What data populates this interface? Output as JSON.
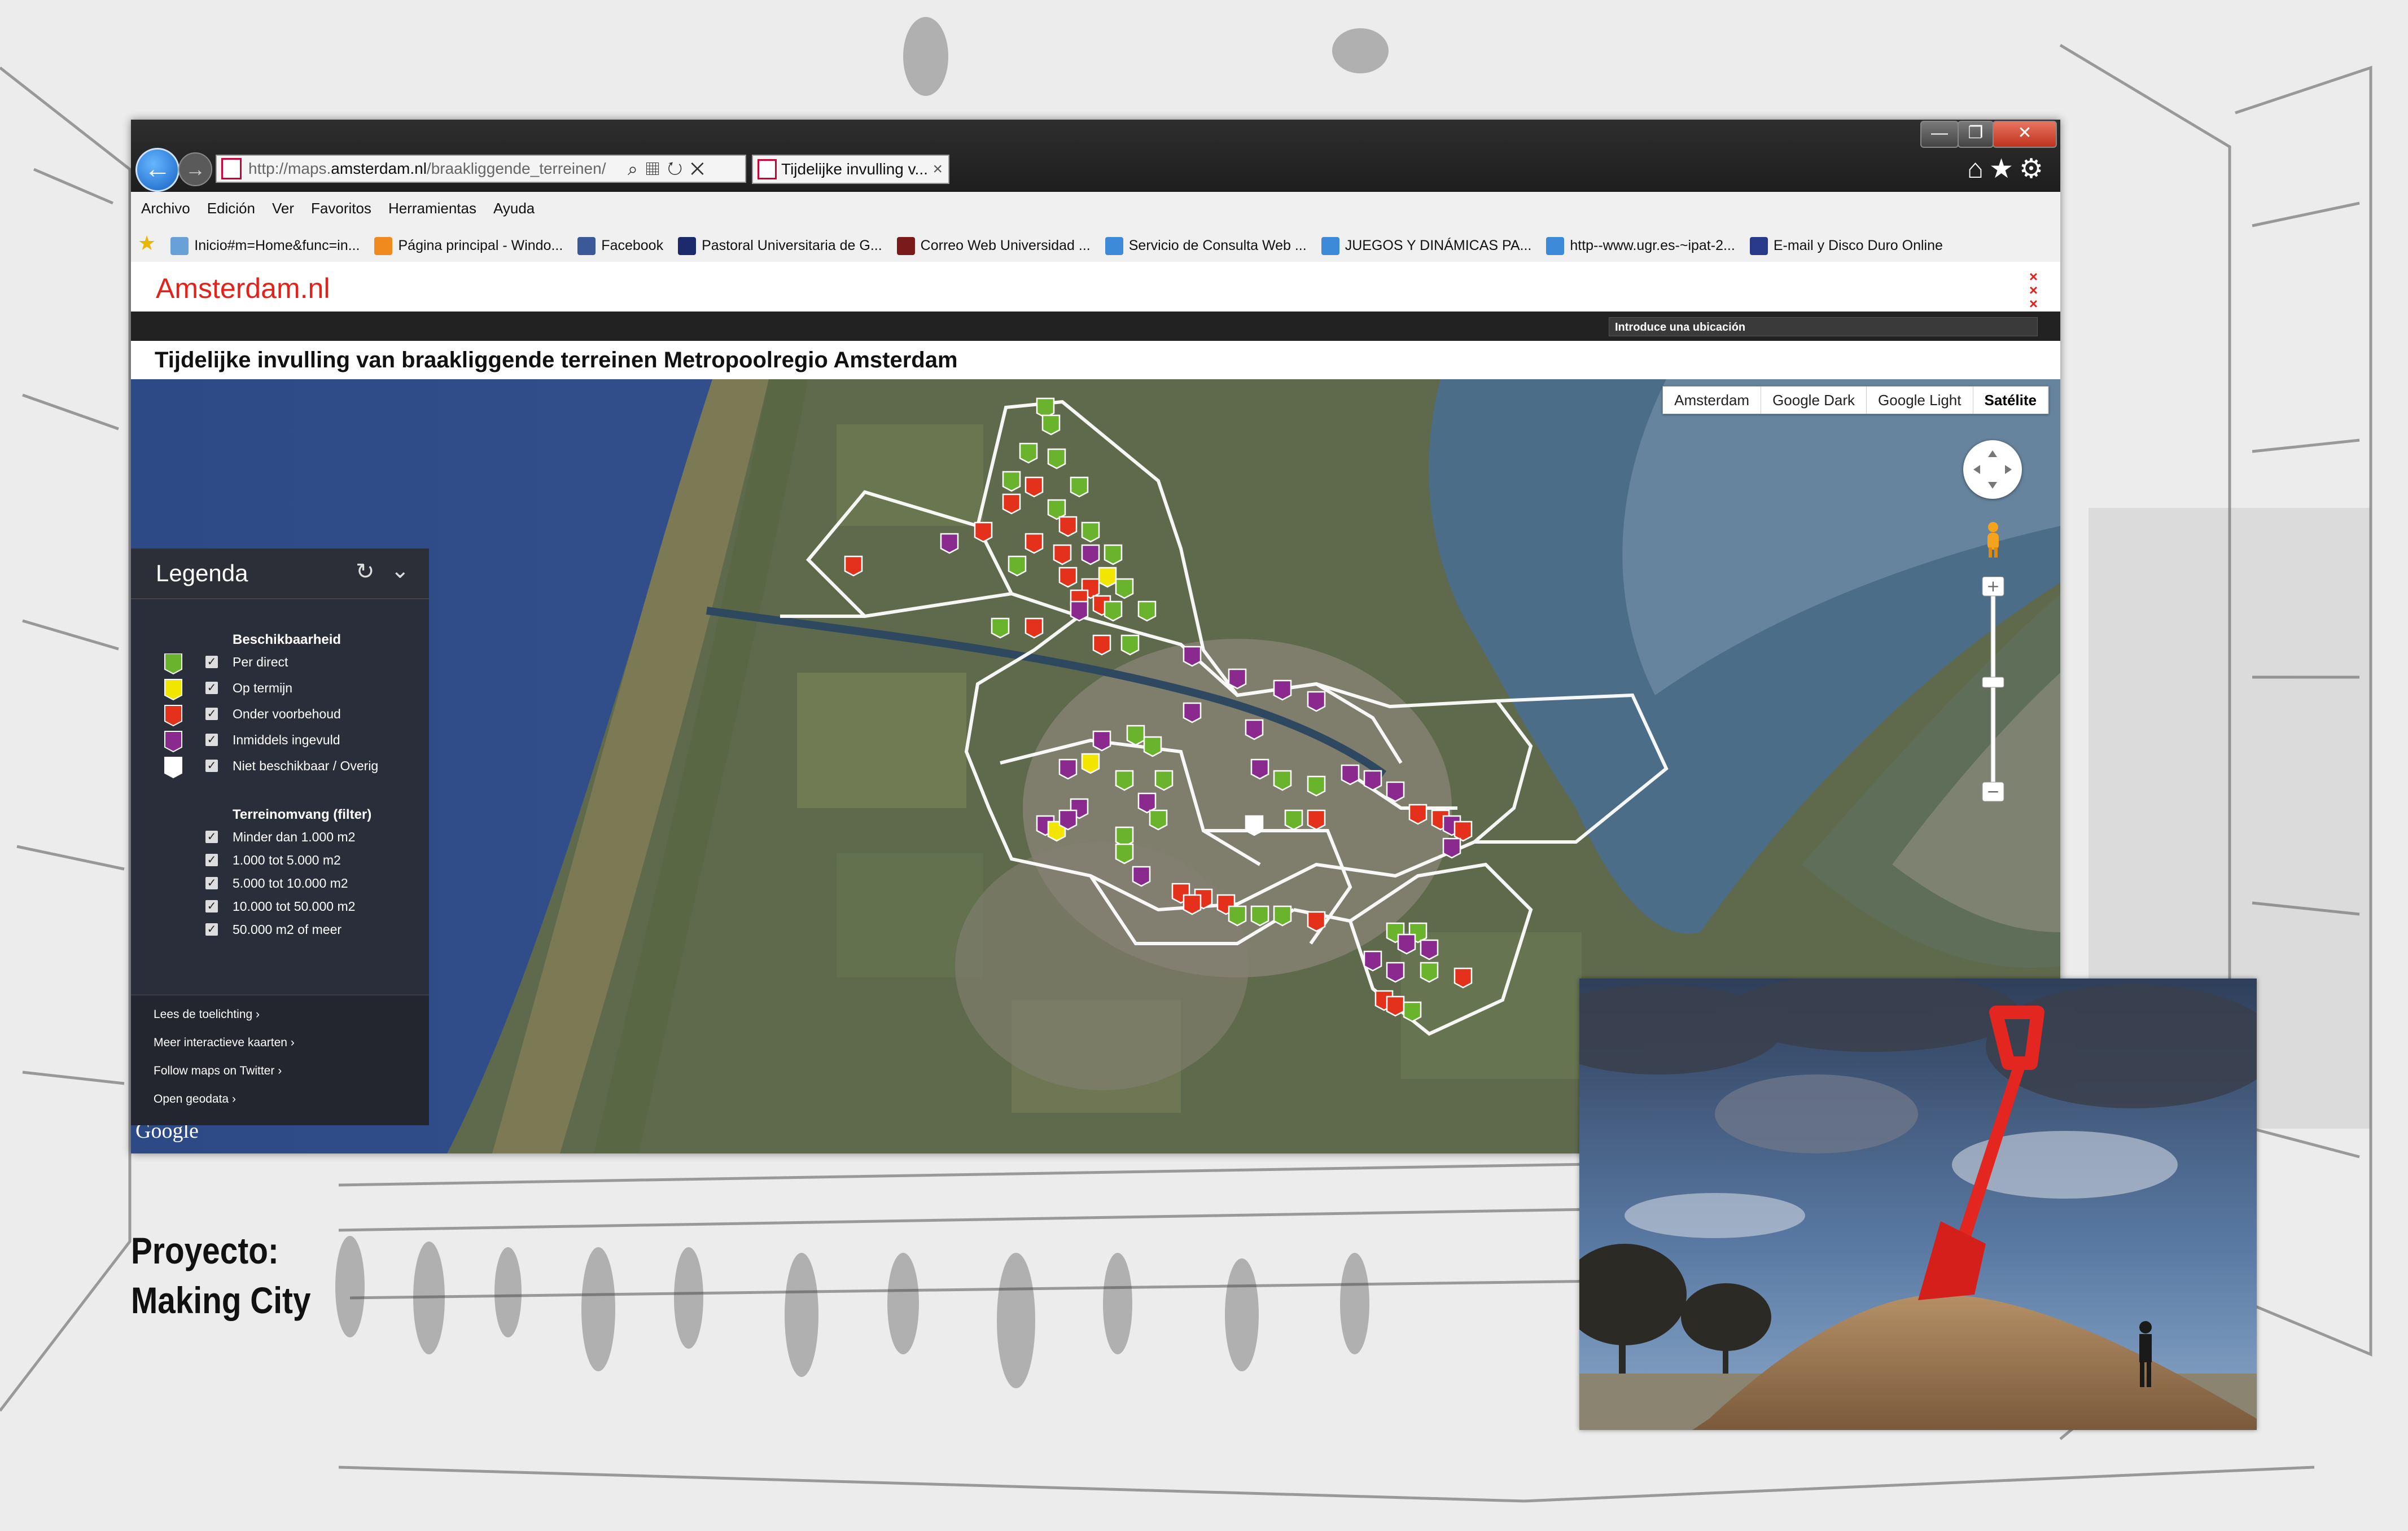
{
  "browser": {
    "address_prefix": "http://maps.",
    "address_domain": "amsterdam.nl",
    "address_path": "/braakliggende_terreinen/",
    "tab_title": "Tijdelijke invulling v...",
    "window_buttons": [
      "—",
      "❐",
      "✕"
    ],
    "menu": [
      "Archivo",
      "Edición",
      "Ver",
      "Favoritos",
      "Herramientas",
      "Ayuda"
    ],
    "favorites": [
      {
        "label": "Inicio#m=Home&func=in...",
        "color": "#6aa0d8"
      },
      {
        "label": "Página principal - Windo...",
        "color": "#f08a1e"
      },
      {
        "label": "Facebook",
        "color": "#3b5998"
      },
      {
        "label": "Pastoral Universitaria de G...",
        "color": "#1a2a6c"
      },
      {
        "label": "Correo Web  Universidad ...",
        "color": "#7a1a1a"
      },
      {
        "label": "Servicio de Consulta Web ...",
        "color": "#3c8ad8"
      },
      {
        "label": "JUEGOS Y DINÁMICAS PA...",
        "color": "#3c8ad8"
      },
      {
        "label": "http--www.ugr.es-~ipat-2...",
        "color": "#3c8ad8"
      },
      {
        "label": "E-mail y Disco Duro Online",
        "color": "#2a3a8a"
      }
    ]
  },
  "site": {
    "logo": "Amsterdam.nl",
    "location_placeholder": "Introduce una ubicación",
    "page_title": "Tijdelijke invulling van braakliggende terreinen Metropoolregio Amsterdam"
  },
  "map": {
    "types": [
      "Amsterdam",
      "Google Dark",
      "Google Light",
      "Satélite"
    ],
    "active_type": "Satélite",
    "google_logo": "Google",
    "colors": {
      "green": "#6ab42d",
      "yellow": "#f2e600",
      "red": "#e4311b",
      "purple": "#8a2a8e",
      "white": "#ffffff"
    }
  },
  "legend": {
    "title": "Legenda",
    "availability_heading": "Beschikbaarheid",
    "availability": [
      {
        "label": "Per direct",
        "color": "#6ab42d"
      },
      {
        "label": "Op termijn",
        "color": "#f2e600"
      },
      {
        "label": "Onder voorbehoud",
        "color": "#e4311b"
      },
      {
        "label": "Inmiddels ingevuld",
        "color": "#8a2a8e"
      },
      {
        "label": "Niet beschikbaar / Overig",
        "color": "#ffffff"
      }
    ],
    "size_heading": "Terreinomvang (filter)",
    "sizes": [
      "Minder dan 1.000 m2",
      "1.000 tot 5.000 m2",
      "5.000 tot 10.000 m2",
      "10.000 tot 50.000 m2",
      "50.000 m2 of meer"
    ],
    "links": [
      "Lees de toelichting",
      "Meer interactieve kaarten",
      "Follow maps on Twitter",
      "Open geodata"
    ]
  },
  "caption": {
    "line1": "Proyecto:",
    "line2": "Making City"
  }
}
